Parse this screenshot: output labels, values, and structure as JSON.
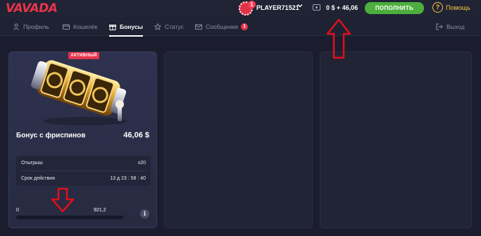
{
  "header": {
    "logo": "VAVADA",
    "avatar_badge": "1",
    "username": "PLAYER71521",
    "balance": "0 $ + 46,06",
    "deposit_label": "ПОПОЛНИТЬ",
    "help_label": "Помощь"
  },
  "nav": {
    "tabs": [
      {
        "label": "Профиль",
        "icon": "user-icon"
      },
      {
        "label": "Кошелёк",
        "icon": "wallet-icon"
      },
      {
        "label": "Бонусы",
        "icon": "gift-icon",
        "active": true
      },
      {
        "label": "Статус",
        "icon": "star-icon"
      },
      {
        "label": "Сообщения",
        "icon": "mail-icon",
        "badge": "1"
      }
    ],
    "logout_label": "Выход"
  },
  "bonus_card": {
    "badge": "АКТИВНЫЙ",
    "title": "Бонус с фриспинов",
    "amount": "46,06 $",
    "wager_label": "Отыгрыш",
    "wager_value": "x20",
    "expiry_label": "Срок действия",
    "expiry_value": "13 д 23 : 58 : 40",
    "progress_min": "0",
    "progress_max": "921,2",
    "progress_fraction": 0,
    "info_icon": "i"
  },
  "colors": {
    "brand": "#e8344a",
    "deposit": "#4caf3d",
    "help": "#f5c542",
    "background": "#1b1d2e",
    "annotation": "#e0101a"
  }
}
